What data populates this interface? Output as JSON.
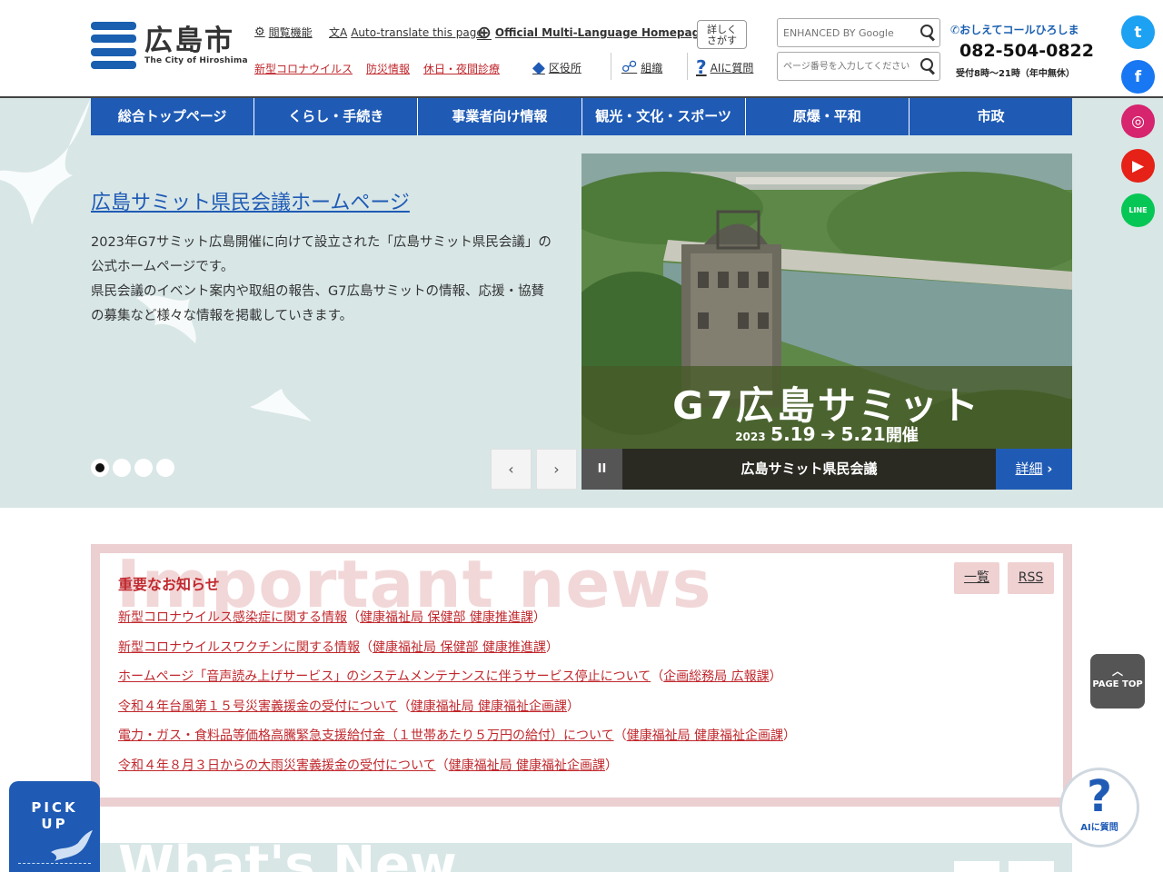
{
  "header": {
    "logo": {
      "ja": "広島市",
      "en": "The City of Hiroshima"
    },
    "utility": {
      "browse": "閲覧機能",
      "translate": "Auto-translate this page",
      "multilang": "Official Multi-Language Homepage",
      "detail": "詳しく\nさがす",
      "ward": "区役所",
      "org": "組織",
      "ai": "AIに質問"
    },
    "red_links": [
      "新型コロナウイルス",
      "防災情報",
      "休日・夜間診療"
    ],
    "search": {
      "google_placeholder": "ENHANCED BY Google",
      "page_placeholder": "ページ番号を入力してください"
    },
    "call": {
      "title": "おしえてコールひろしま",
      "number": "082-504-0822",
      "hours": "受付8時～21時（年中無休）"
    }
  },
  "nav": [
    "総合トップページ",
    "くらし・手続き",
    "事業者向け情報",
    "観光・文化・スポーツ",
    "原爆・平和",
    "市政"
  ],
  "slide": {
    "title": "広島サミット県民会議ホームページ",
    "desc": "2023年G7サミット広島開催に向けて設立された「広島サミット県民会議」の公式ホームページです。\n県民会議のイベント案内や取組の報告、G7広島サミットの情報、応援・協賛の募集など様々な情報を掲載していきます。",
    "image_title": "G7広島サミット",
    "image_year": "2023",
    "image_dates": "5.19",
    "image_dates_end": "5.21",
    "image_kai": "開催",
    "bar_label": "広島サミット県民会議",
    "more": "詳細",
    "pause": "II",
    "prev": "‹",
    "next": "›",
    "dot_count": 4,
    "active_dot": 0
  },
  "important_news": {
    "bg_text": "Important news",
    "heading": "重要なお知らせ",
    "list_button": "一覧",
    "rss_button": "RSS",
    "items": [
      {
        "title": "新型コロナウイルス感染症に関する情報",
        "dept": "健康福祉局 保健部 健康推進課"
      },
      {
        "title": "新型コロナウイルスワクチンに関する情報",
        "dept": "健康福祉局 保健部 健康推進課"
      },
      {
        "title": "ホームページ「音声読み上げサービス」のシステムメンテナンスに伴うサービス停止について",
        "dept": "企画総務局 広報課"
      },
      {
        "title": "令和４年台風第１５号災害義援金の受付について",
        "dept": "健康福祉局 健康福祉企画課"
      },
      {
        "title": "電力・ガス・食料品等価格高騰緊急支援給付金（１世帯あたり５万円の給付）について",
        "dept": "健康福祉局 健康福祉企画課"
      },
      {
        "title": "令和４年８月３日からの大雨災害義援金の受付について",
        "dept": "健康福祉局 健康福祉企画課"
      }
    ]
  },
  "whats_new": {
    "bg_text": "What's New"
  },
  "floating": {
    "pagetop": "PAGE TOP",
    "ai": "AIに質問",
    "ai_mark": "?",
    "pickup_line1": "PICK",
    "pickup_line2": "UP"
  },
  "social": [
    {
      "name": "twitter-icon",
      "glyph": "t",
      "color": "#1da1f2"
    },
    {
      "name": "facebook-icon",
      "glyph": "f",
      "color": "#1877f2"
    },
    {
      "name": "instagram-icon",
      "glyph": "◎",
      "color": "#d6246e"
    },
    {
      "name": "youtube-icon",
      "glyph": "▶",
      "color": "#e62117"
    },
    {
      "name": "line-icon",
      "glyph": "LINE",
      "color": "#06c755"
    }
  ]
}
